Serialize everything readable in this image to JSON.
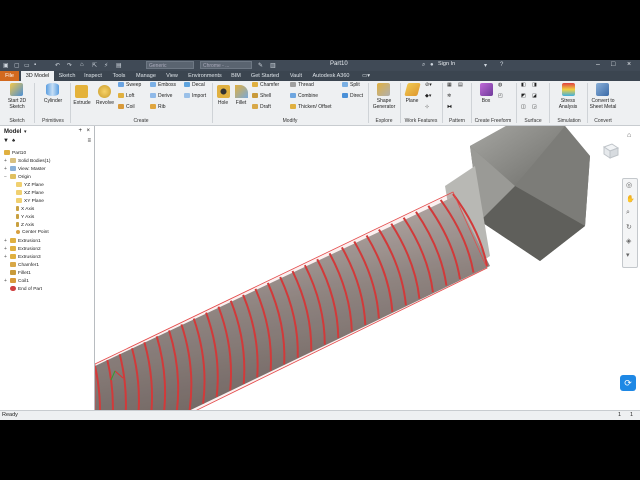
{
  "titlebar": {
    "material": "Generic",
    "appearance": "Chrome - ...",
    "document_title": "Part10",
    "sign_in": "Sign In",
    "help": "?"
  },
  "tabs": [
    "File",
    "3D Model",
    "Sketch",
    "Inspect",
    "Tools",
    "Manage",
    "View",
    "Environments",
    "BIM",
    "Get Started",
    "Vault",
    "Autodesk A360",
    "▭▾"
  ],
  "ribbon": {
    "sketch": {
      "start_sketch": "Start 2D Sketch",
      "panel": "Sketch"
    },
    "primitives": {
      "cylinder": "Cylinder",
      "panel": "Primitives"
    },
    "create": {
      "extrude": "Extrude",
      "revolve": "Revolve",
      "col1": [
        "Sweep",
        "Loft",
        "Coil"
      ],
      "col2": [
        "Emboss",
        "Derive",
        "Rib"
      ],
      "col3": [
        "Decal",
        "Import"
      ],
      "panel": "Create"
    },
    "modify": {
      "hole": "Hole",
      "fillet": "Fillet",
      "col1": [
        "Chamfer",
        "Shell",
        "Draft"
      ],
      "col2": [
        "Thread",
        "Combine",
        "Thicken/ Offset"
      ],
      "col3": [
        "Split",
        "Direct"
      ],
      "panel": "Modify"
    },
    "explore": {
      "shape_generator": "Shape Generator",
      "panel": "Explore"
    },
    "work_features": {
      "plane": "Plane",
      "panel": "Work Features"
    },
    "pattern": {
      "panel": "Pattern"
    },
    "create_freeform": {
      "box": "Box",
      "panel": "Create Freeform"
    },
    "surface": {
      "panel": "Surface"
    },
    "simulation": {
      "stress": "Stress Analysis",
      "panel": "Simulation"
    },
    "convert": {
      "sheet_metal": "Convert to Sheet Metal",
      "panel": "Convert"
    }
  },
  "browser": {
    "title": "Model",
    "items": [
      "Part10",
      "Solid Bodies(1)",
      "View: Master",
      "Origin",
      "YZ Plane",
      "XZ Plane",
      "XY Plane",
      "X Axis",
      "Y Axis",
      "Z Axis",
      "Center Point",
      "Extrusion1",
      "Extrusion2",
      "Extrusion3",
      "Chamfer1",
      "Fillet1",
      "Coil1",
      "End of Part"
    ]
  },
  "status": {
    "text": "Ready",
    "count1": "1",
    "count2": "1"
  },
  "colors": {
    "file_tab": "#d2691e",
    "thread_red": "#d23a3a",
    "bolt_gray": "#8a8a86",
    "titlebar": "#404a56"
  }
}
